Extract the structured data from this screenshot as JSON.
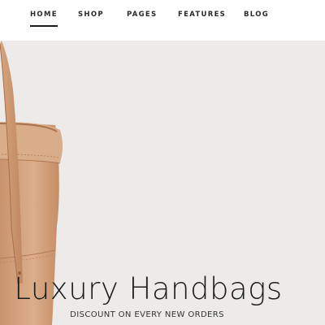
{
  "nav": {
    "items": [
      {
        "label": "HOME",
        "active": true
      },
      {
        "label": "SHOP",
        "active": false
      },
      {
        "label": "PAGES",
        "active": false
      },
      {
        "label": "FEATURES",
        "active": false
      },
      {
        "label": "BLOG",
        "active": false
      }
    ]
  },
  "hero": {
    "title": "Luxury Handbags",
    "subtitle": "DISCOUNT ON EVERY NEW ORDERS"
  },
  "colors": {
    "background": "#ecebea",
    "leather": "#d4a582",
    "text": "#1c1c1c"
  }
}
